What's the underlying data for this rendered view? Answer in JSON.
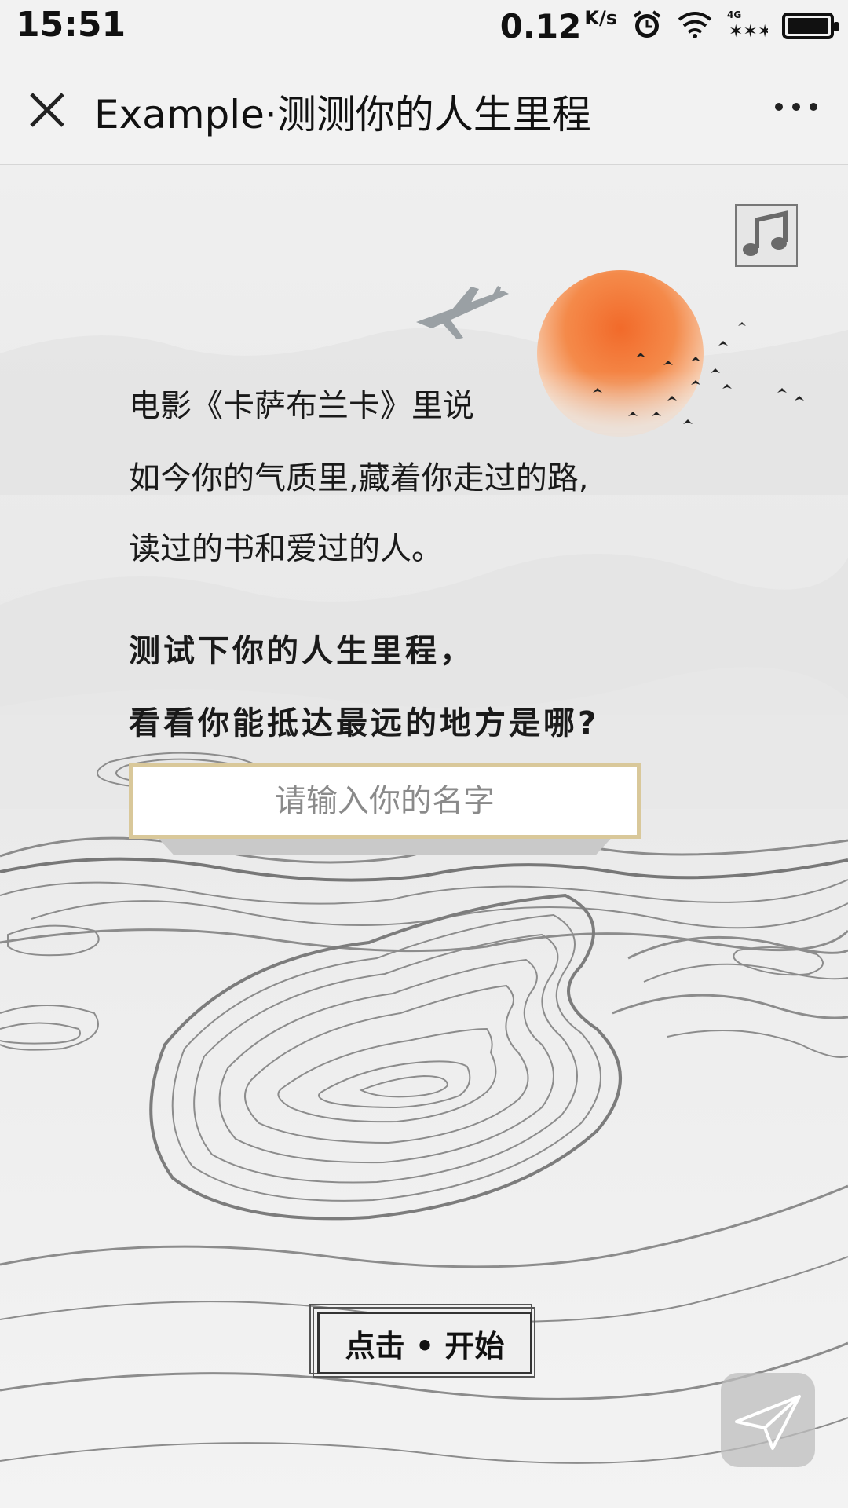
{
  "status_bar": {
    "time": "15:51",
    "speed": "0.12",
    "speed_unit": "K/s",
    "network": "4G",
    "icons": [
      "alarm-icon",
      "wifi-icon",
      "signal-icon",
      "battery-icon"
    ]
  },
  "navbar": {
    "title": "Example·测测你的人生里程",
    "close_icon": "close-icon",
    "more_icon": "more-icon"
  },
  "page": {
    "intro_lines": [
      "电影《卡萨布兰卡》里说",
      "如今你的气质里,藏着你走过的路,",
      "读过的书和爱过的人。"
    ],
    "ask_lines": [
      "测试下你的人生里程，",
      "看看你能抵达最远的地方是哪?"
    ],
    "name_input": {
      "placeholder": "请输入你的名字",
      "value": ""
    },
    "start_button": "点击 • 开始",
    "music_icon": "music-note-icon",
    "share_icon": "paper-plane-icon"
  },
  "colors": {
    "sun": "#f06a2a",
    "input_border": "#d9c89a",
    "background": "#efefef"
  }
}
